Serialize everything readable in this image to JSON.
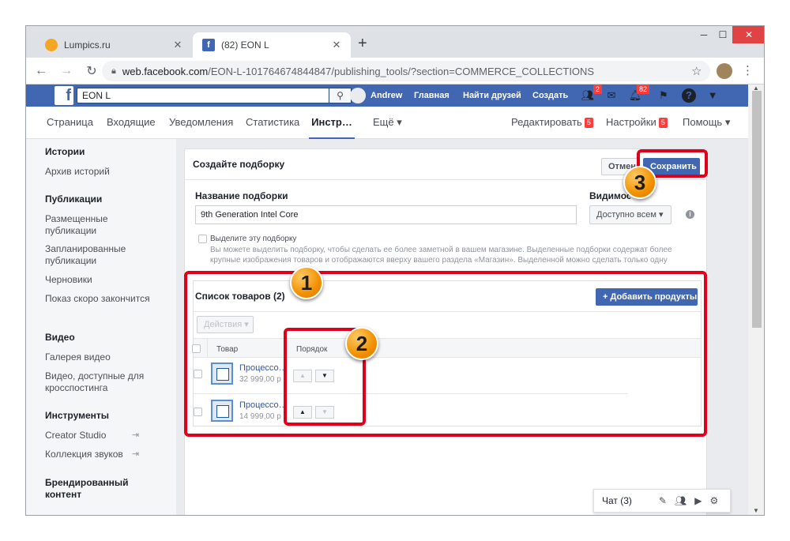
{
  "browser": {
    "tabs": [
      {
        "title": "Lumpics.ru",
        "favicon": "lumpics-favicon",
        "active": false
      },
      {
        "title": "(82) EON L",
        "favicon": "facebook-favicon",
        "active": true
      }
    ],
    "new_tab": "+",
    "url_host": "web.facebook.com",
    "url_path": "/EON-L-101764674844847/publishing_tools/?section=COMMERCE_COLLECTIONS"
  },
  "fb_header": {
    "logo": "f",
    "search_value": "EON L",
    "user_name": "Andrew",
    "nav": [
      "Главная",
      "Найти друзей",
      "Создать"
    ],
    "friend_badge": "2",
    "notif_badge": "82"
  },
  "page_nav": {
    "items": [
      "Страница",
      "Входящие",
      "Уведомления",
      "Статистика",
      "Инстр…",
      "Ещё ▾"
    ],
    "active_index": 4,
    "edit_label": "Редактировать",
    "edit_badge": "5",
    "settings_label": "Настройки",
    "settings_badge": "5",
    "help_label": "Помощь ▾"
  },
  "sidebar": {
    "sections": [
      {
        "heading": "Истории",
        "items": [
          "Архив историй"
        ]
      },
      {
        "heading": "Публикации",
        "items": [
          "Размещенные публикации",
          "Запланированные публикации",
          "Черновики",
          "Показ скоро закончится"
        ]
      },
      {
        "heading": "Видео",
        "items": [
          "Галерея видео",
          "Видео, доступные для кросспостинга"
        ]
      },
      {
        "heading": "Инструменты",
        "items": [
          "Creator Studio",
          "Коллекция звуков"
        ]
      },
      {
        "heading": "Брендированный контент",
        "items": []
      }
    ]
  },
  "card": {
    "title": "Создайте подборку",
    "cancel_label": "Отмена",
    "save_label": "Сохранить",
    "name_label": "Название подборки",
    "name_value": "9th Generation Intel Core",
    "visibility_label": "Видимость",
    "visibility_value": "Доступно всем ▾",
    "feature_label": "Выделите эту подборку",
    "feature_desc": "Вы можете выделить подборку, чтобы сделать ее более заметной в вашем магазине. Выделенные подборки содержат более крупные изображения товаров и отображаются вверху вашего раздела «Магазин». Выделенной можно сделать только одну подборку.",
    "list_title": "Список товаров (2)",
    "add_products_label": "+ Добавить продукты",
    "actions_label": "Действия ▾",
    "col_product": "Товар",
    "col_order": "Порядок",
    "products": [
      {
        "name": "Процессо…",
        "price": "32 999,00 р"
      },
      {
        "name": "Процессо…",
        "price": "14 999,00 р"
      }
    ]
  },
  "markers": [
    "1",
    "2",
    "3"
  ],
  "chat": {
    "label": "Чат (3)"
  },
  "colors": {
    "fb_blue": "#4267b2",
    "annotation_red": "#e0001b",
    "marker_orange": "#f29000"
  }
}
